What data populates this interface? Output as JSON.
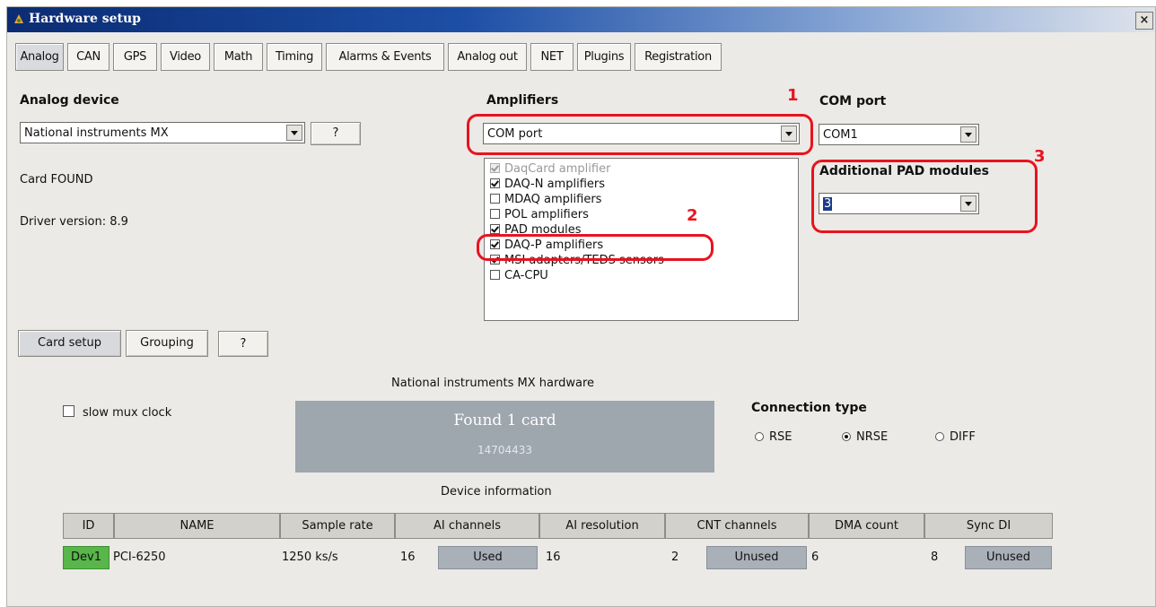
{
  "window": {
    "title": "Hardware setup",
    "close_label": "×"
  },
  "tabs": [
    "Analog",
    "CAN",
    "GPS",
    "Video",
    "Math",
    "Timing",
    "Alarms & Events",
    "Analog out",
    "NET",
    "Plugins",
    "Registration"
  ],
  "analog_device": {
    "label": "Analog device",
    "value": "National instruments MX",
    "help_label": "?"
  },
  "status": {
    "card": "Card FOUND",
    "driver": "Driver version: 8.9"
  },
  "amplifiers": {
    "label": "Amplifiers",
    "value": "COM port",
    "items": [
      {
        "label": "DaqCard amplifier",
        "checked": true,
        "disabled": true
      },
      {
        "label": "DAQ-N amplifiers",
        "checked": true
      },
      {
        "label": "MDAQ amplifiers",
        "checked": false
      },
      {
        "label": "POL amplifiers",
        "checked": false
      },
      {
        "label": "PAD modules",
        "checked": true
      },
      {
        "label": "DAQ-P amplifiers",
        "checked": true
      },
      {
        "label": "MSI adapters/TEDS sensors",
        "checked": true
      },
      {
        "label": "CA-CPU",
        "checked": false
      }
    ]
  },
  "com_port": {
    "label": "COM port",
    "value": "COM1"
  },
  "pad_modules": {
    "label": "Additional PAD modules",
    "value": "3"
  },
  "annotations": {
    "one": "1",
    "two": "2",
    "three": "3",
    "color": "#e8131f"
  },
  "sub_buttons": {
    "card_setup": "Card setup",
    "grouping": "Grouping",
    "help": "?"
  },
  "slow_mux": {
    "label": "slow mux clock",
    "checked": false
  },
  "hardware": {
    "title": "National instruments MX hardware",
    "found": "Found 1 card",
    "serial": "14704433"
  },
  "connection": {
    "label": "Connection type",
    "options": [
      "RSE",
      "NRSE",
      "DIFF"
    ],
    "selected": "NRSE"
  },
  "device_info": {
    "title": "Device information",
    "headers": [
      "ID",
      "NAME",
      "Sample rate",
      "AI channels",
      "AI resolution",
      "CNT channels",
      "DMA count",
      "Sync DI"
    ],
    "row": {
      "id": "Dev1",
      "name": "PCI-6250",
      "sample_rate": "1250 ks/s",
      "ai_channels": "16",
      "ai_used": "Used",
      "ai_resolution": "16",
      "cnt_channels": "2",
      "cnt_state": "Unused",
      "dma_count": "6",
      "sync_di": "8",
      "sync_state": "Unused"
    }
  }
}
